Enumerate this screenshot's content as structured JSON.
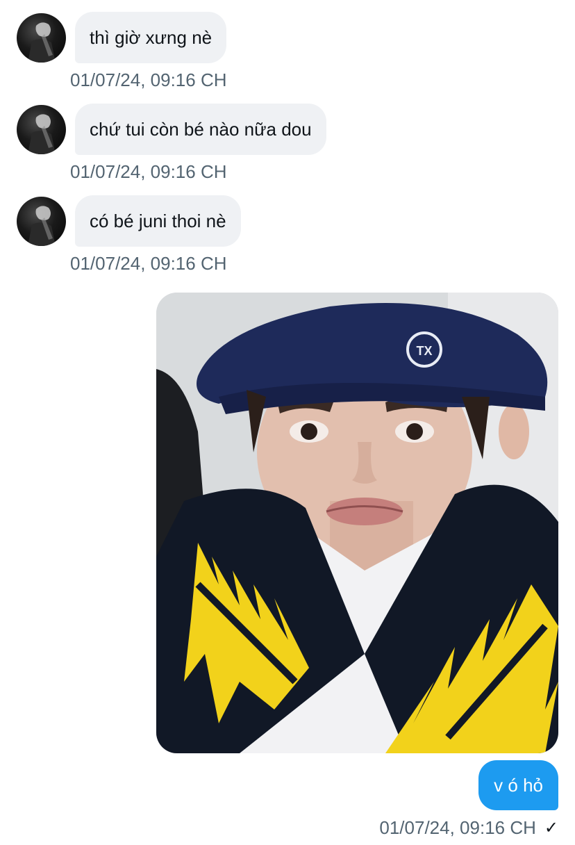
{
  "messages_in": [
    {
      "text": "thì giờ xưng nè",
      "timestamp": "01/07/24, 09:16 CH"
    },
    {
      "text": "chứ tui còn bé nào nữa dou",
      "timestamp": "01/07/24, 09:16 CH"
    },
    {
      "text": "có bé juni thoi nè",
      "timestamp": "01/07/24, 09:16 CH"
    }
  ],
  "message_out": {
    "image": "photo-of-person-in-navy-beret",
    "text": "v ó hỏ",
    "timestamp": "01/07/24, 09:16 CH",
    "status_icon": "checkmark-icon",
    "status_glyph": "✓"
  },
  "colors": {
    "incoming_bubble": "#eff1f4",
    "outgoing_bubble": "#1d9bf0",
    "timestamp": "#536471"
  }
}
